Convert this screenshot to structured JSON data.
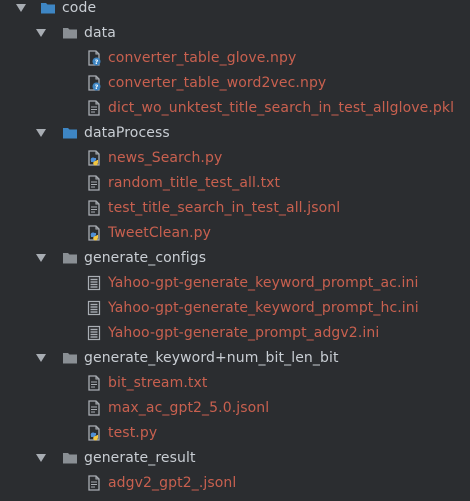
{
  "colors": {
    "background": "#2b2d30",
    "folder_text": "#c9ced4",
    "file_text": "#c8604f",
    "folder_gray": "#8a8f94",
    "folder_blue": "#3e86c4",
    "file_gray": "#a8adb3"
  },
  "tree": [
    {
      "label": "code",
      "type": "folder",
      "depth": 0,
      "icon": "folder-blue-icon",
      "expanded": true
    },
    {
      "label": "data",
      "type": "folder",
      "depth": 1,
      "icon": "folder-icon",
      "expanded": true
    },
    {
      "label": "converter_table_glove.npy",
      "type": "file",
      "depth": 2,
      "icon": "unknown-file-icon"
    },
    {
      "label": "converter_table_word2vec.npy",
      "type": "file",
      "depth": 2,
      "icon": "unknown-file-icon"
    },
    {
      "label": "dict_wo_unktest_title_search_in_test_allglove.pkl",
      "type": "file",
      "depth": 2,
      "icon": "text-file-icon"
    },
    {
      "label": "dataProcess",
      "type": "folder",
      "depth": 1,
      "icon": "folder-blue-icon",
      "expanded": true
    },
    {
      "label": "news_Search.py",
      "type": "file",
      "depth": 2,
      "icon": "python-file-icon"
    },
    {
      "label": "random_title_test_all.txt",
      "type": "file",
      "depth": 2,
      "icon": "text-file-icon"
    },
    {
      "label": "test_title_search_in_test_all.jsonl",
      "type": "file",
      "depth": 2,
      "icon": "text-file-icon"
    },
    {
      "label": "TweetClean.py",
      "type": "file",
      "depth": 2,
      "icon": "python-file-icon"
    },
    {
      "label": "generate_configs",
      "type": "folder",
      "depth": 1,
      "icon": "folder-icon",
      "expanded": true
    },
    {
      "label": "Yahoo-gpt-generate_keyword_prompt_ac.ini",
      "type": "file",
      "depth": 2,
      "icon": "config-file-icon"
    },
    {
      "label": "Yahoo-gpt-generate_keyword_prompt_hc.ini",
      "type": "file",
      "depth": 2,
      "icon": "config-file-icon"
    },
    {
      "label": "Yahoo-gpt-generate_prompt_adgv2.ini",
      "type": "file",
      "depth": 2,
      "icon": "config-file-icon"
    },
    {
      "label": "generate_keyword+num_bit_len_bit",
      "type": "folder",
      "depth": 1,
      "icon": "folder-icon",
      "expanded": true
    },
    {
      "label": "bit_stream.txt",
      "type": "file",
      "depth": 2,
      "icon": "text-file-icon"
    },
    {
      "label": "max_ac_gpt2_5.0.jsonl",
      "type": "file",
      "depth": 2,
      "icon": "text-file-icon"
    },
    {
      "label": "test.py",
      "type": "file",
      "depth": 2,
      "icon": "python-file-icon"
    },
    {
      "label": "generate_result",
      "type": "folder",
      "depth": 1,
      "icon": "folder-icon",
      "expanded": true
    },
    {
      "label": "adgv2_gpt2_.jsonl",
      "type": "file",
      "depth": 2,
      "icon": "text-file-icon"
    }
  ]
}
